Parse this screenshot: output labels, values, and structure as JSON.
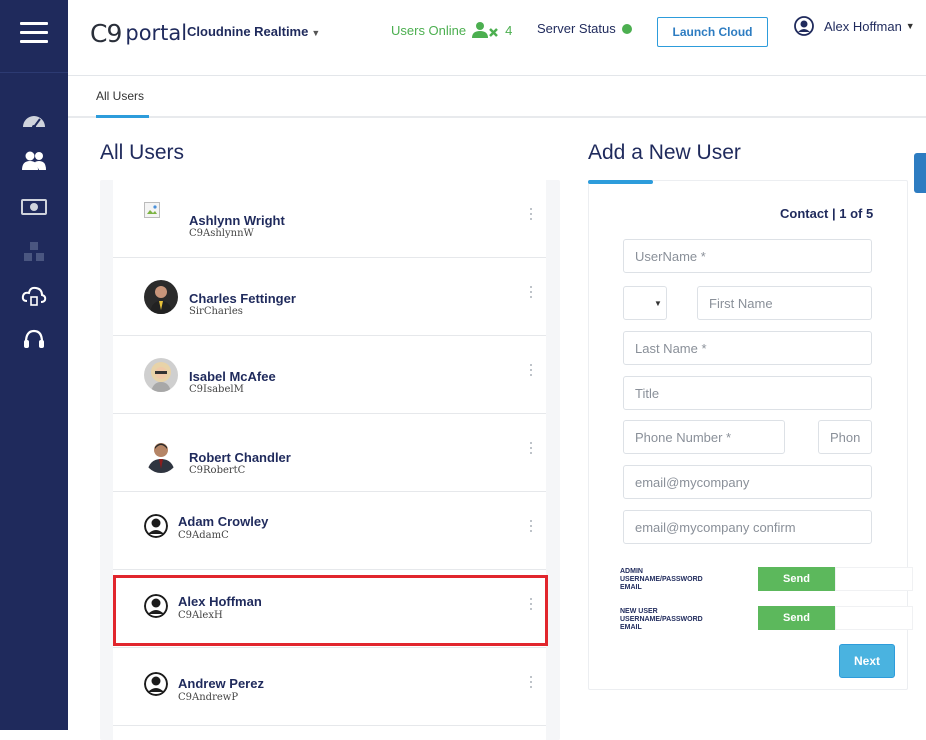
{
  "app": {
    "logo_c9": "C9",
    "logo_portal": "portal",
    "org_name": "Cloudnine Realtime"
  },
  "header": {
    "users_online_label": "Users Online",
    "users_online_count": "4",
    "server_status_label": "Server Status",
    "server_status_color": "#4caf50",
    "launch_cloud_label": "Launch Cloud",
    "current_user": "Alex Hoffman"
  },
  "sidebar": {
    "items": [
      {
        "icon": "dashboard-gauge-icon"
      },
      {
        "icon": "users-icon"
      },
      {
        "icon": "billing-money-icon"
      },
      {
        "icon": "modules-cubes-icon"
      },
      {
        "icon": "cloud-icon"
      },
      {
        "icon": "support-headset-icon"
      }
    ]
  },
  "tabs": {
    "active_label": "All Users"
  },
  "users_panel": {
    "title": "All Users",
    "users": [
      {
        "name": "Ashlynn Wright",
        "login": "C9AshlynnW",
        "avatar": "broken-image"
      },
      {
        "name": "Charles Fettinger",
        "login": "SirCharles",
        "avatar": "photo"
      },
      {
        "name": "Isabel McAfee",
        "login": "C9IsabelM",
        "avatar": "photo"
      },
      {
        "name": "Robert Chandler",
        "login": "C9RobertC",
        "avatar": "photo"
      },
      {
        "name": "Adam Crowley",
        "login": "C9AdamC",
        "avatar": "placeholder"
      },
      {
        "name": "Alex Hoffman",
        "login": "C9AlexH",
        "avatar": "placeholder",
        "selected": true
      },
      {
        "name": "Andrew Perez",
        "login": "C9AndrewP",
        "avatar": "placeholder"
      }
    ]
  },
  "add_user_form": {
    "title": "Add a New User",
    "step_label": "Contact | 1 of 5",
    "fields": {
      "username": "UserName *",
      "prefix": "",
      "first_name": "First Name",
      "last_name": "Last Name *",
      "title": "Title",
      "phone": "Phone Number *",
      "phone_ext": "Phon",
      "email": "email@mycompany",
      "email_confirm": "email@mycompany confirm"
    },
    "toggles": [
      {
        "label_line1": "ADMIN",
        "label_line2": "USERNAME/PASSWORD",
        "label_line3": "EMAIL",
        "button": "Send"
      },
      {
        "label_line1": "NEW USER",
        "label_line2": "USERNAME/PASSWORD",
        "label_line3": "EMAIL",
        "button": "Send"
      }
    ],
    "next_label": "Next"
  },
  "colors": {
    "sidebar_bg": "#1f2a5c",
    "accent_blue": "#2d9cdb",
    "online_green": "#4caf50",
    "send_green": "#5cb85c",
    "selection_red": "#e1262d"
  }
}
